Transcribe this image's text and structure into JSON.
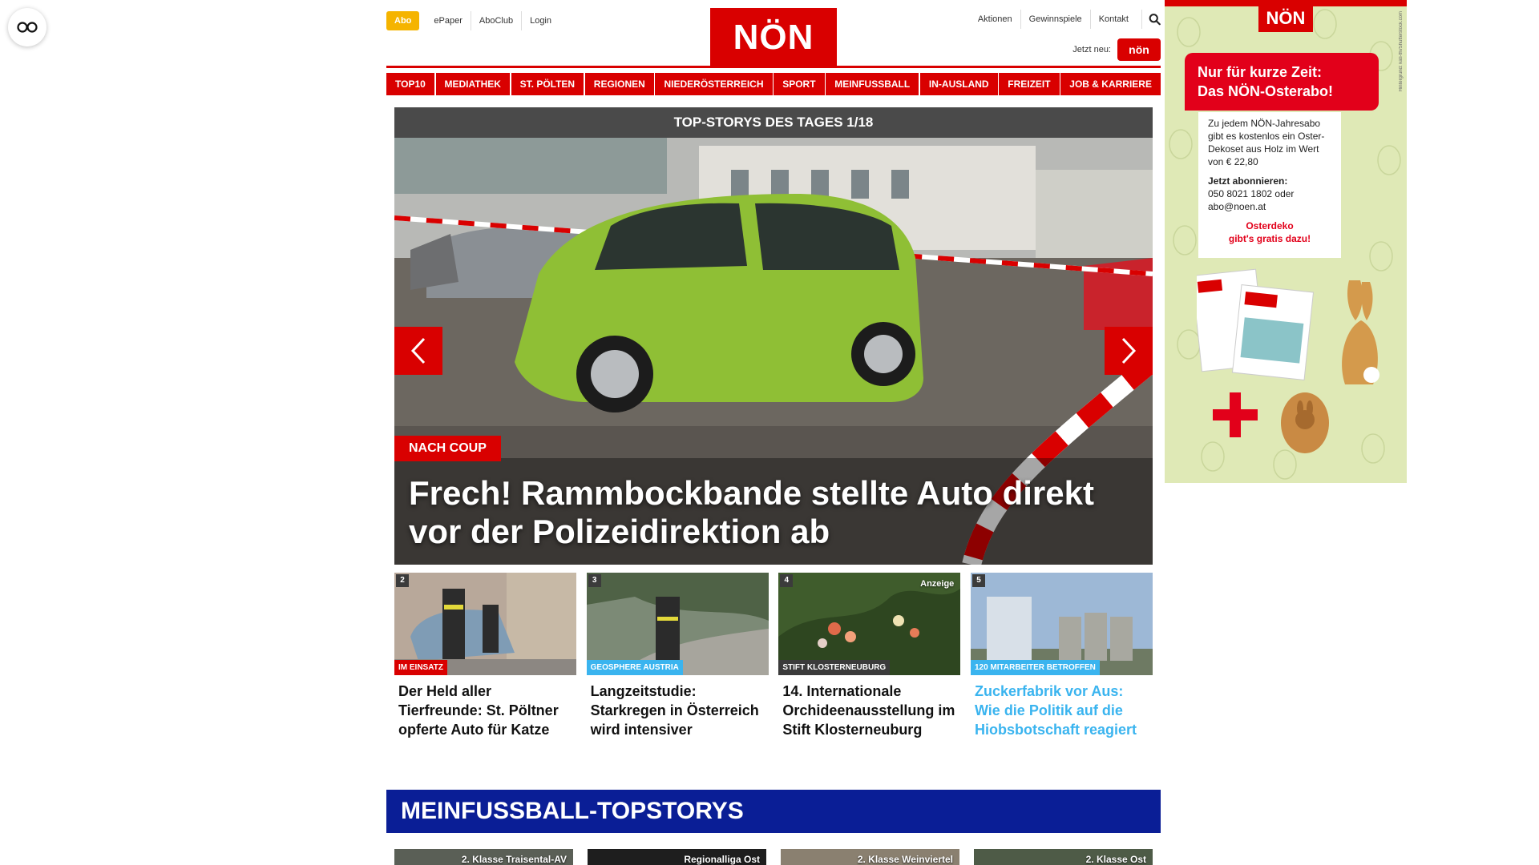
{
  "header": {
    "abo_label": "Abo",
    "left_links": [
      "ePaper",
      "AboClub",
      "Login"
    ],
    "logo_text": "NÖN",
    "right_links": [
      "Aktionen",
      "Gewinnspiele",
      "Kontakt"
    ],
    "jetzt_neu_label": "Jetzt neu:",
    "mini_badge_text": "nön"
  },
  "nav": [
    "TOP10",
    "MEDIATHEK",
    "ST. PÖLTEN",
    "REGIONEN",
    "NIEDERÖSTERREICH",
    "SPORT",
    "MEINFUSSBALL",
    "IN-AUSLAND",
    "FREIZEIT",
    "JOB & KARRIERE"
  ],
  "hero": {
    "heading": "TOP-STORYS DES TAGES 1/18",
    "tag": "NACH COUP",
    "title": "Frech! Rammbockbande stellte Auto direkt vor der Polizeidirektion ab"
  },
  "teasers": [
    {
      "num": "2",
      "tag": "IM EINSATZ",
      "tag_color": "#d90000",
      "title": "Der Held aller Tierfreunde: St. Pöltner opferte Auto für Katze",
      "ad": ""
    },
    {
      "num": "3",
      "tag": "GEOSPHERE AUSTRIA",
      "tag_color": "#3ab4ef",
      "title": "Langzeitstudie: Starkregen in Österreich wird intensiver",
      "ad": ""
    },
    {
      "num": "4",
      "tag": "STIFT KLOSTERNEUBURG",
      "tag_color": "#3b3b3b",
      "title": "14. Internationale Orchideenausstellung im Stift Klosterneuburg",
      "ad": "Anzeige"
    },
    {
      "num": "5",
      "tag": "120 MITARBEITER BETROFFEN",
      "tag_color": "#3ab4ef",
      "title": "Zuckerfabrik vor Aus: Wie die Politik auf die Hiobsbotschaft reagiert",
      "ad": ""
    }
  ],
  "section": {
    "title": "MEINFUSSBALL-TOPSTORYS",
    "cards": [
      "2. Klasse Traisental-AV",
      "Regionalliga Ost",
      "2. Klasse Weinviertel",
      "2. Klasse Ost"
    ]
  },
  "ad": {
    "logo": "NÖN",
    "headline_1": "Nur für kurze Zeit:",
    "headline_2": "Das NÖN-Osterabo!",
    "body": "Zu jedem NÖN-Jahresabo gibt es kostenlos ein Oster-Dekoset aus Holz im Wert von € 22,80",
    "cta_label": "Jetzt abonnieren:",
    "cta_contact": "050 8021 1802 oder abo@noen.at",
    "promo_1": "Osterdeko",
    "promo_2": "gibt's gratis dazu!",
    "side_text": "Hintergrund: kati-thi/Shutterstock.com"
  },
  "colors": {
    "brand_red": "#d90000",
    "abo_yellow": "#f5b400",
    "section_blue": "#0a1e96",
    "teaser_blue": "#3ab4ef"
  }
}
